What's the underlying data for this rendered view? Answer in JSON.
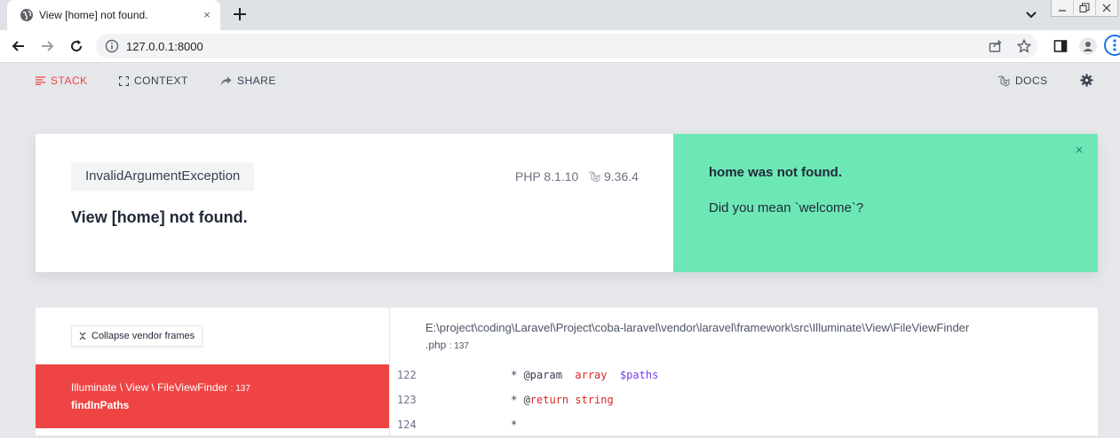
{
  "browser": {
    "tab_title": "View [home] not found.",
    "tab_close": "×",
    "url": "127.0.0.1:8000"
  },
  "ignition_nav": {
    "stack": "STACK",
    "context": "CONTEXT",
    "share": "SHARE",
    "docs": "DOCS"
  },
  "error": {
    "exception_class": "InvalidArgumentException",
    "php_version": "PHP 8.1.10",
    "laravel_version": "9.36.4",
    "message": "View [home] not found."
  },
  "solution": {
    "title": "home was not found.",
    "text": "Did you mean `welcome`?",
    "close": "×"
  },
  "stack": {
    "collapse_label": "Collapse vendor frames",
    "active_frame": {
      "file": "Illuminate \\ View \\ FileViewFinder",
      "line": ": 137",
      "method": "findInPaths"
    },
    "code": {
      "path": "E:\\project\\coding\\Laravel\\Project\\coba-laravel\\vendor\\laravel\\framework\\src\\Illuminate\\View\\FileViewFinder",
      "ext": ".php",
      "line": ": 137",
      "lines": [
        {
          "num": "122",
          "prefix": "     * @param  ",
          "type": "array",
          "mid": "  ",
          "var": "$paths"
        },
        {
          "num": "123",
          "prefix": "     * @",
          "type": "return",
          "mid": " string",
          "var": ""
        },
        {
          "num": "124",
          "prefix": "     *",
          "type": "",
          "mid": "",
          "var": ""
        }
      ]
    }
  },
  "colors": {
    "accent": "#ef4444",
    "solution_bg": "#6ee7b7",
    "background": "#e5e7eb"
  }
}
